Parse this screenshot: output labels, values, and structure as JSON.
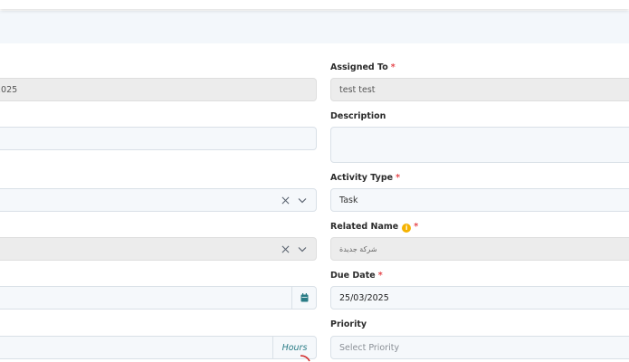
{
  "left": {
    "date_fragment": "2025",
    "hours_suffix": "Hours"
  },
  "right": {
    "assigned_to": {
      "label": "Assigned To",
      "required": "*",
      "value": "test test"
    },
    "description": {
      "label": "Description",
      "value": ""
    },
    "activity_type": {
      "label": "Activity Type",
      "required": "*",
      "value": "Task"
    },
    "related_name": {
      "label": "Related Name",
      "required": "*",
      "info": "i",
      "value": "شركة جديدة"
    },
    "due_date": {
      "label": "Due Date",
      "required": "*",
      "value": "25/03/2025"
    },
    "priority": {
      "label": "Priority",
      "placeholder": "Select Priority"
    }
  },
  "icons": {
    "clear": "close-icon",
    "dropdown": "chevron-down-icon",
    "calendar": "calendar-icon"
  },
  "colors": {
    "required": "#e5484d",
    "accent": "#2a7c86",
    "info": "#f5b301"
  }
}
